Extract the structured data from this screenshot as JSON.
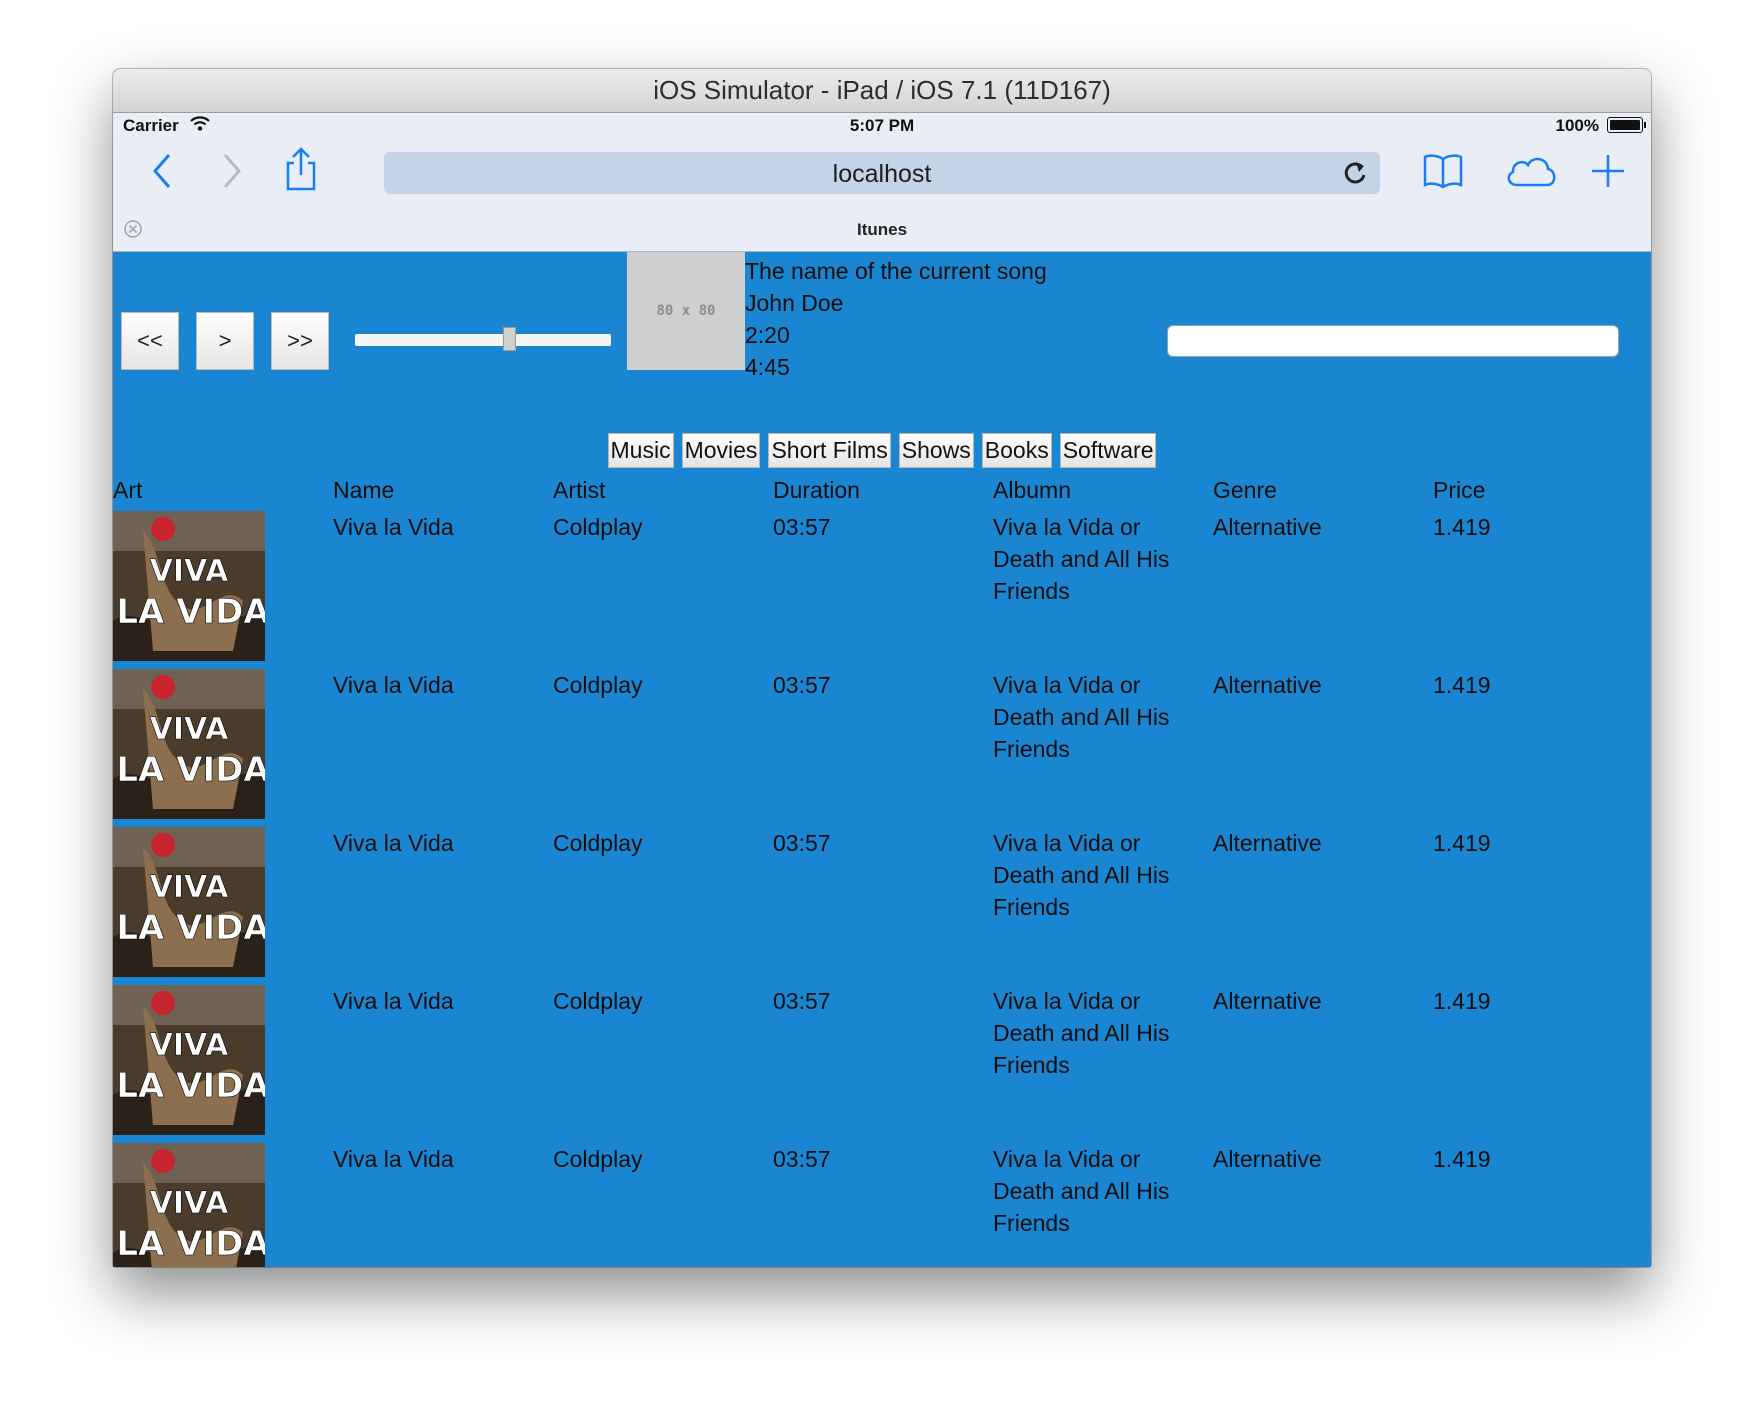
{
  "window": {
    "title": "iOS Simulator - iPad / iOS 7.1 (11D167)"
  },
  "status_bar": {
    "carrier": "Carrier",
    "time": "5:07 PM",
    "battery": "100%"
  },
  "browser": {
    "url": "localhost",
    "tab_title": "Itunes"
  },
  "player": {
    "prev_label": "<<",
    "play_label": ">",
    "next_label": ">>",
    "volume_fraction": 0.6,
    "artwork_placeholder": "80 x 80",
    "song_name": "The name of the current song",
    "artist": "John Doe",
    "elapsed": "2:20",
    "total": "4:45",
    "search_value": ""
  },
  "categories": [
    "Music",
    "Movies",
    "Short Films",
    "Shows",
    "Books",
    "Software"
  ],
  "table": {
    "headers": [
      "Art",
      "Name",
      "Artist",
      "Duration",
      "Albumn",
      "Genre",
      "Price"
    ],
    "rows": [
      {
        "name": "Viva la Vida",
        "artist": "Coldplay",
        "duration": "03:57",
        "album": "Viva la Vida or Death and All His Friends",
        "genre": "Alternative",
        "price": "1.419"
      },
      {
        "name": "Viva la Vida",
        "artist": "Coldplay",
        "duration": "03:57",
        "album": "Viva la Vida or Death and All His Friends",
        "genre": "Alternative",
        "price": "1.419"
      },
      {
        "name": "Viva la Vida",
        "artist": "Coldplay",
        "duration": "03:57",
        "album": "Viva la Vida or Death and All His Friends",
        "genre": "Alternative",
        "price": "1.419"
      },
      {
        "name": "Viva la Vida",
        "artist": "Coldplay",
        "duration": "03:57",
        "album": "Viva la Vida or Death and All His Friends",
        "genre": "Alternative",
        "price": "1.419"
      },
      {
        "name": "Viva la Vida",
        "artist": "Coldplay",
        "duration": "03:57",
        "album": "Viva la Vida or Death and All His Friends",
        "genre": "Alternative",
        "price": "1.419"
      }
    ]
  },
  "colors": {
    "page_background": "#1a86d2",
    "chrome": "#e9eef6",
    "accent": "#1a7ef2"
  },
  "icons": [
    "back-icon",
    "forward-icon",
    "share-icon",
    "reload-icon",
    "bookmarks-icon",
    "icloud-tabs-icon",
    "new-tab-icon",
    "tab-close-icon",
    "wifi-icon",
    "battery-icon"
  ]
}
